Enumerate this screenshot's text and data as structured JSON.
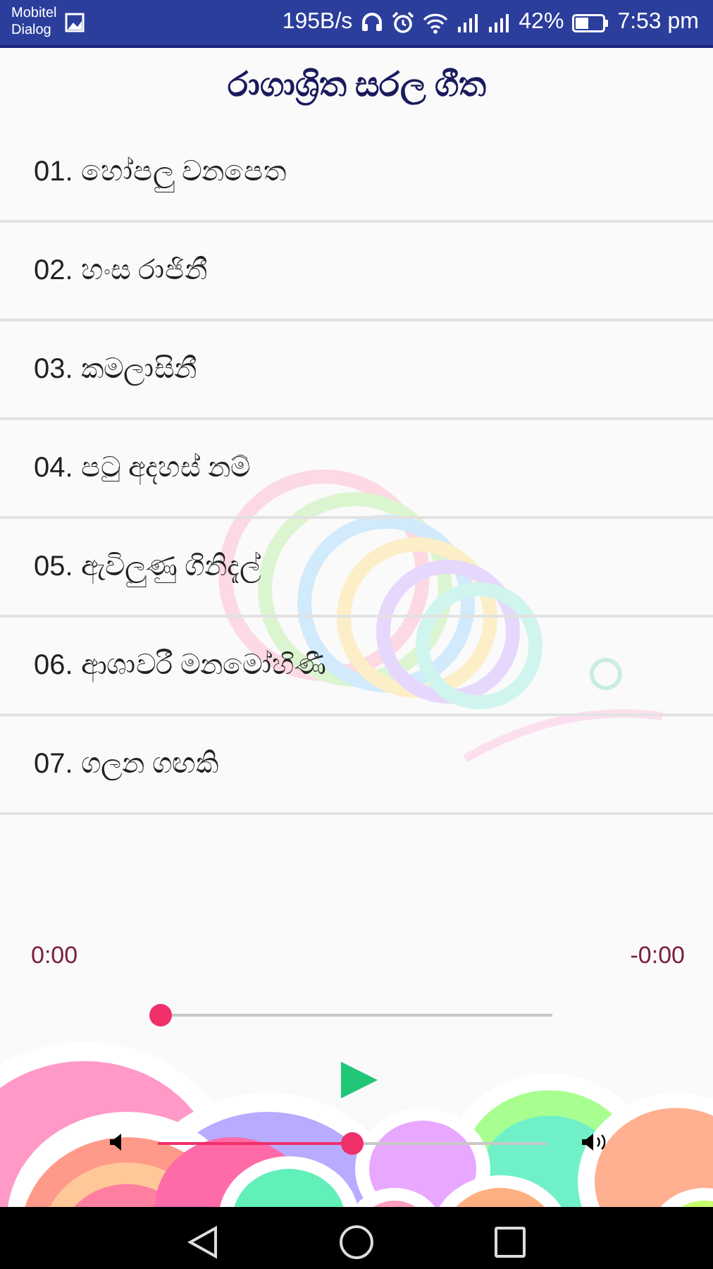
{
  "status_bar": {
    "carriers": [
      "Mobitel",
      "Dialog"
    ],
    "speed": "195B/s",
    "battery": "42%",
    "time": "7:53 pm"
  },
  "title": "රාගාශ්‍රිත සරල ගීත",
  "songs": [
    {
      "label": "01. හෝපලු වනපෙත"
    },
    {
      "label": "02. හංස රාජිනී"
    },
    {
      "label": "03. කමලාසිනී"
    },
    {
      "label": "04. පටු අදහස් නම්"
    },
    {
      "label": "05. ඇවිලුණු ගිනිදැල්"
    },
    {
      "label": "06. ආශාවරී මනමෝහිණී"
    },
    {
      "label": "07. ගලන ගඟකි"
    }
  ],
  "player": {
    "elapsed": "0:00",
    "remaining": "-0:00",
    "seek": {
      "level": 0
    },
    "volume": {
      "level": 0.5
    }
  }
}
